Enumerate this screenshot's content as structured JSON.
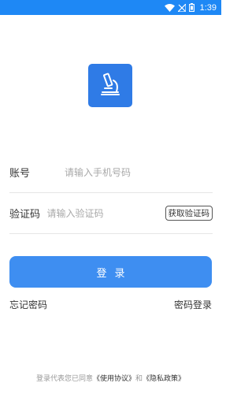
{
  "status_bar": {
    "time": "1:39",
    "icons": [
      "wifi-icon",
      "no-signal-icon",
      "battery-icon"
    ],
    "color": "#1e88f5"
  },
  "logo": {
    "icon": "microscope-icon",
    "color": "#2f7be6"
  },
  "form": {
    "account": {
      "label": "账号",
      "placeholder": "请输入手机号码",
      "value": ""
    },
    "code": {
      "label": "验证码",
      "placeholder": "请输入验证码",
      "value": "",
      "get_code_label": "获取验证码"
    }
  },
  "login_button": {
    "label": "登录",
    "color": "#3e8ef1"
  },
  "links": {
    "forgot_password": "忘记密码",
    "password_login": "密码登录"
  },
  "agreement": {
    "prefix": "登录代表您已同意",
    "terms": "《使用协议》",
    "conjunction": "和",
    "privacy": "《隐私政策》"
  }
}
